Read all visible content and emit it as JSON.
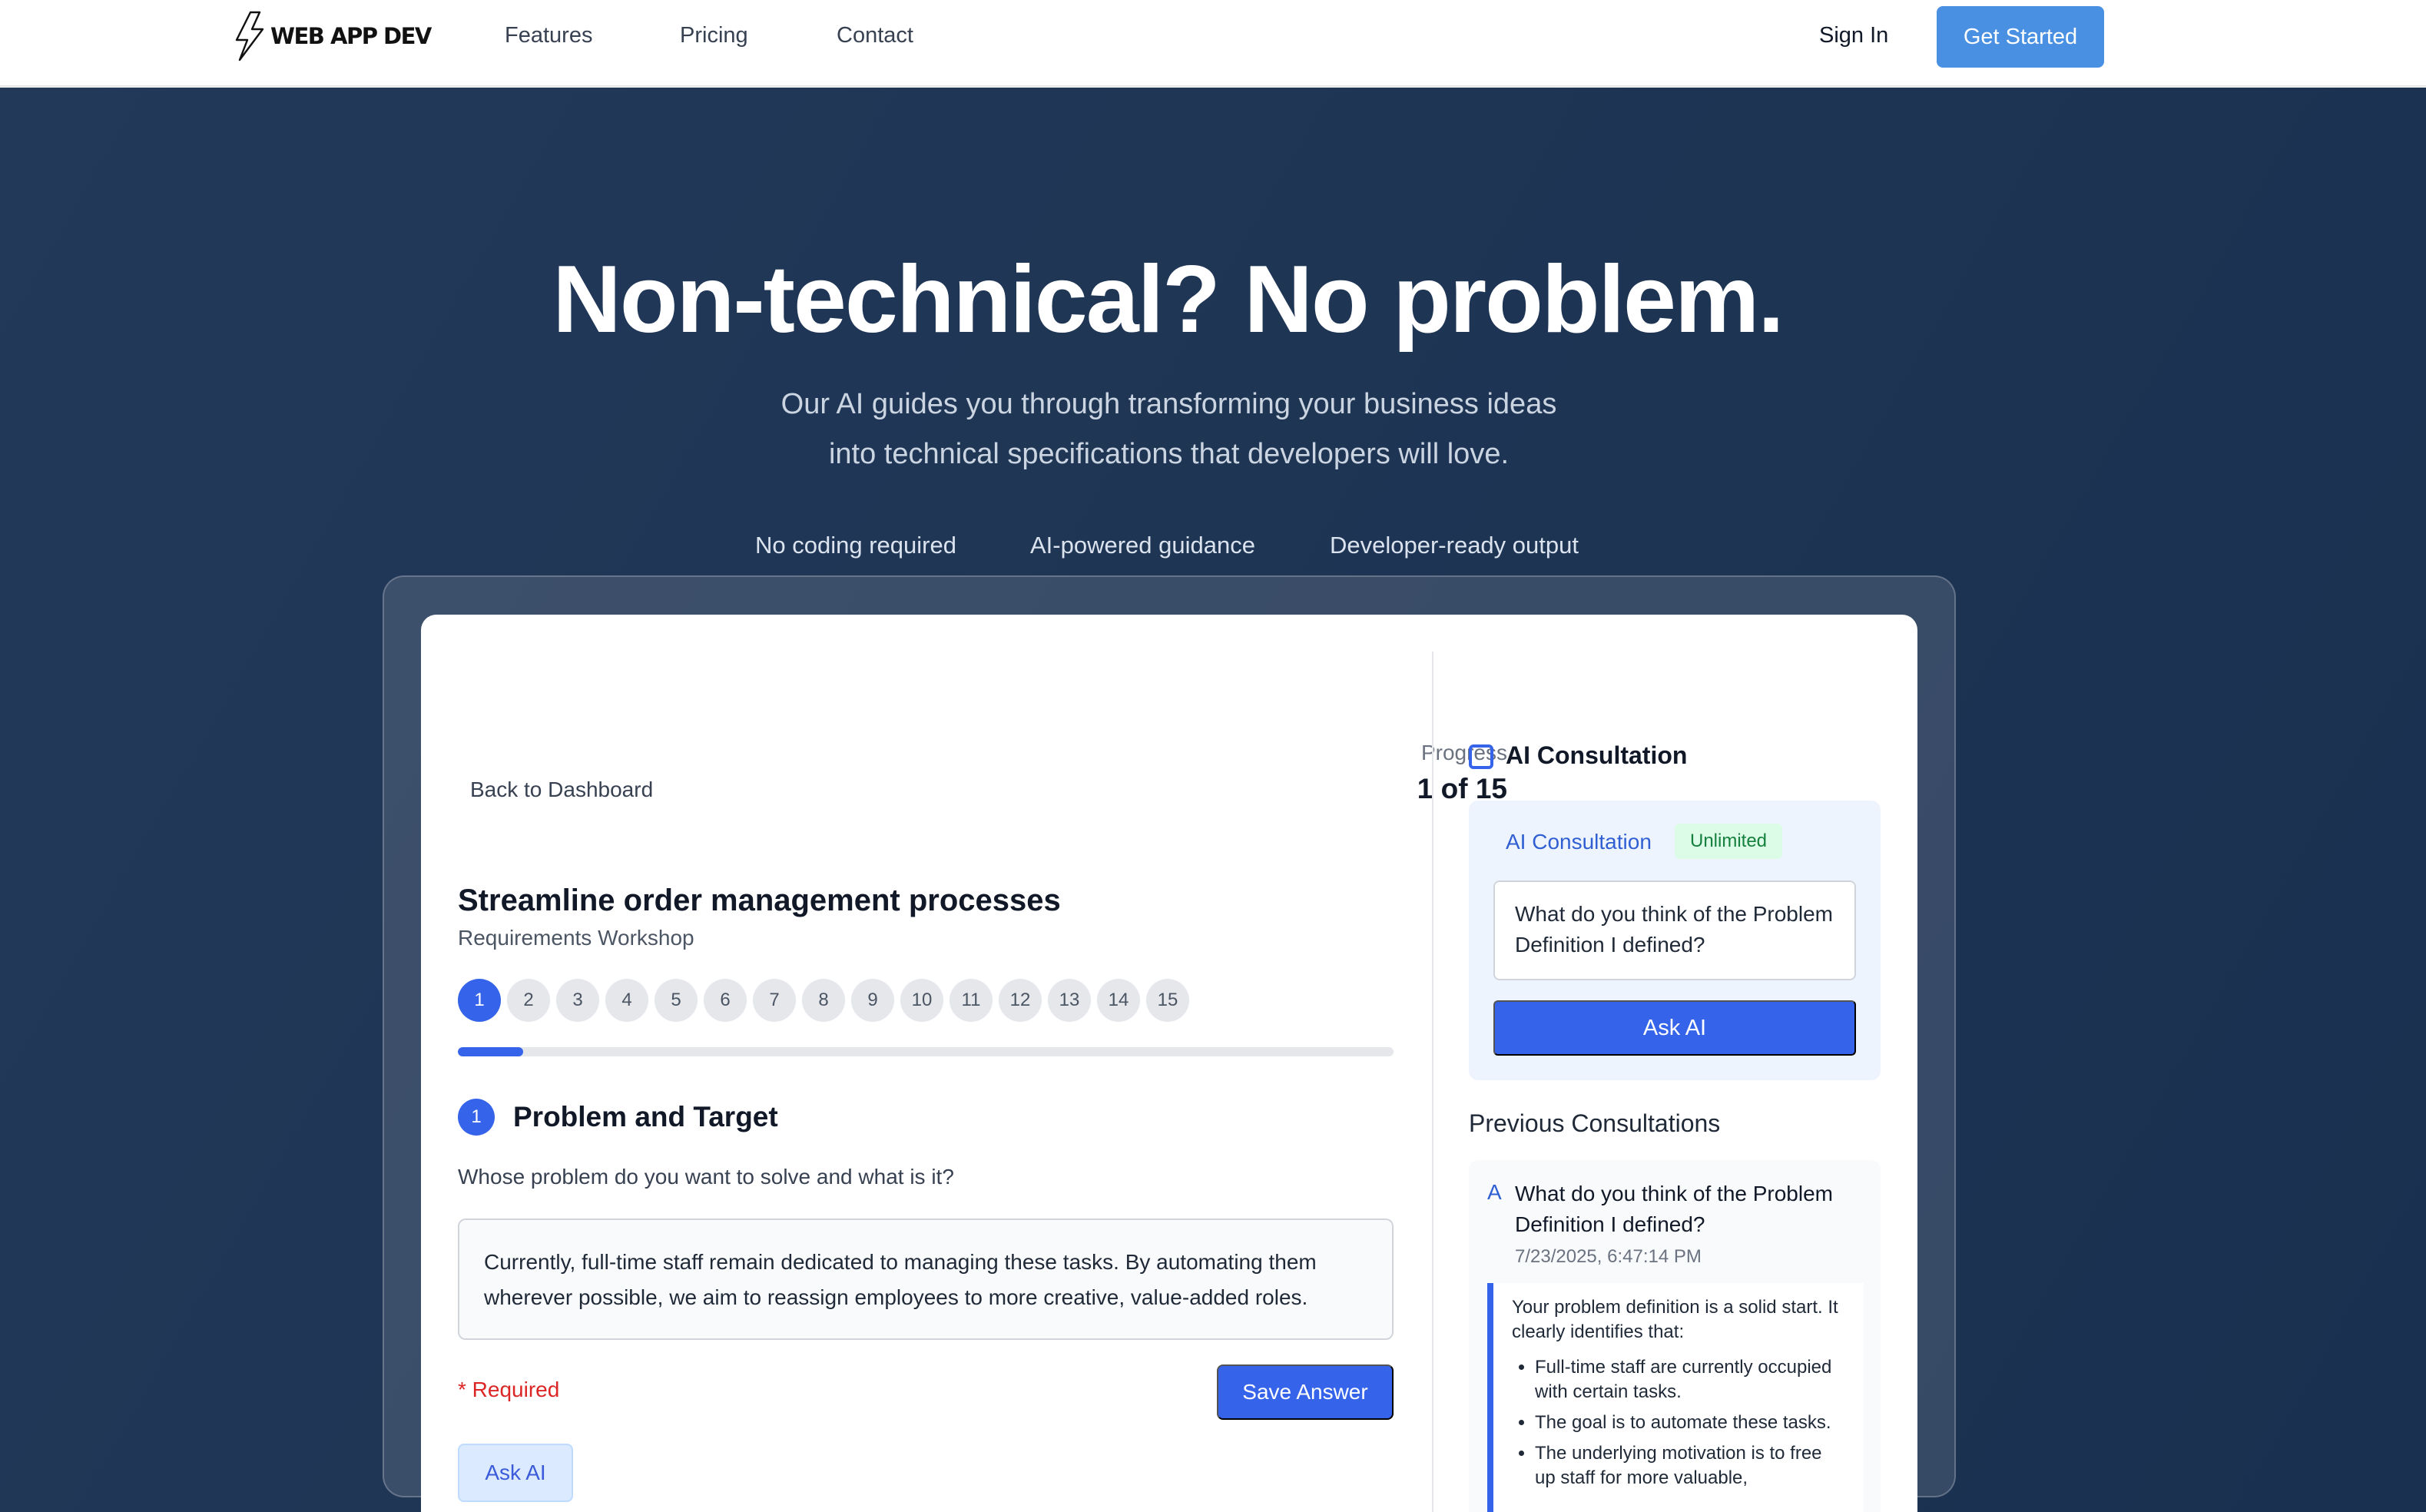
{
  "nav": {
    "logo_text": "WEB APP DEV",
    "links": [
      "Features",
      "Pricing",
      "Contact"
    ],
    "sign_in": "Sign In",
    "get_started": "Get Started"
  },
  "hero": {
    "title": "Non-technical? No problem.",
    "subtitle_line1": "Our AI guides you through transforming your business ideas",
    "subtitle_line2": "into technical specifications that developers will love.",
    "features": [
      "No coding required",
      "AI-powered guidance",
      "Developer-ready output"
    ]
  },
  "workshop": {
    "back_link": "Back to Dashboard",
    "progress_label": "Progress",
    "progress_count": "1 of 15",
    "progress_percent": "7%",
    "progress_fraction": 0.07,
    "title": "Streamline order management processes",
    "subtitle": "Requirements Workshop",
    "steps": [
      "1",
      "2",
      "3",
      "4",
      "5",
      "6",
      "7",
      "8",
      "9",
      "10",
      "11",
      "12",
      "13",
      "14",
      "15"
    ],
    "active_step": 1,
    "question_number": "1",
    "question_title": "Problem and Target",
    "question_text": "Whose problem do you want to solve and what is it?",
    "answer_line1": "Currently, full-time staff remain dedicated to managing these tasks. By automating them",
    "answer_line2": "wherever possible, we aim to reassign employees to more creative, value-added roles.",
    "required_text": "* Required",
    "save_button": "Save Answer",
    "ask_ai_button": "Ask AI"
  },
  "ai": {
    "header": "AI Consultation",
    "panel_title": "AI Consultation",
    "badge": "Unlimited",
    "input_value": "What do you think of the Problem Definition I defined?",
    "ask_button": "Ask AI",
    "previous_title": "Previous Consultations",
    "previous": {
      "marker": "A",
      "question": "What do you think of the Problem Definition I defined?",
      "date": "7/23/2025, 6:47:14 PM",
      "answer_intro": "Your problem definition is a solid start. It clearly identifies that:",
      "bullets": [
        "Full-time staff are currently occupied with certain tasks.",
        "The goal is to automate these tasks.",
        "The underlying motivation is to free up staff for more valuable,"
      ]
    }
  },
  "colors": {
    "accent": "#3563e9",
    "get_started_bg": "#4a90e2",
    "hero_bg": "#1f3554",
    "required": "#dc2626",
    "unlimited_bg": "#dcfce7"
  }
}
